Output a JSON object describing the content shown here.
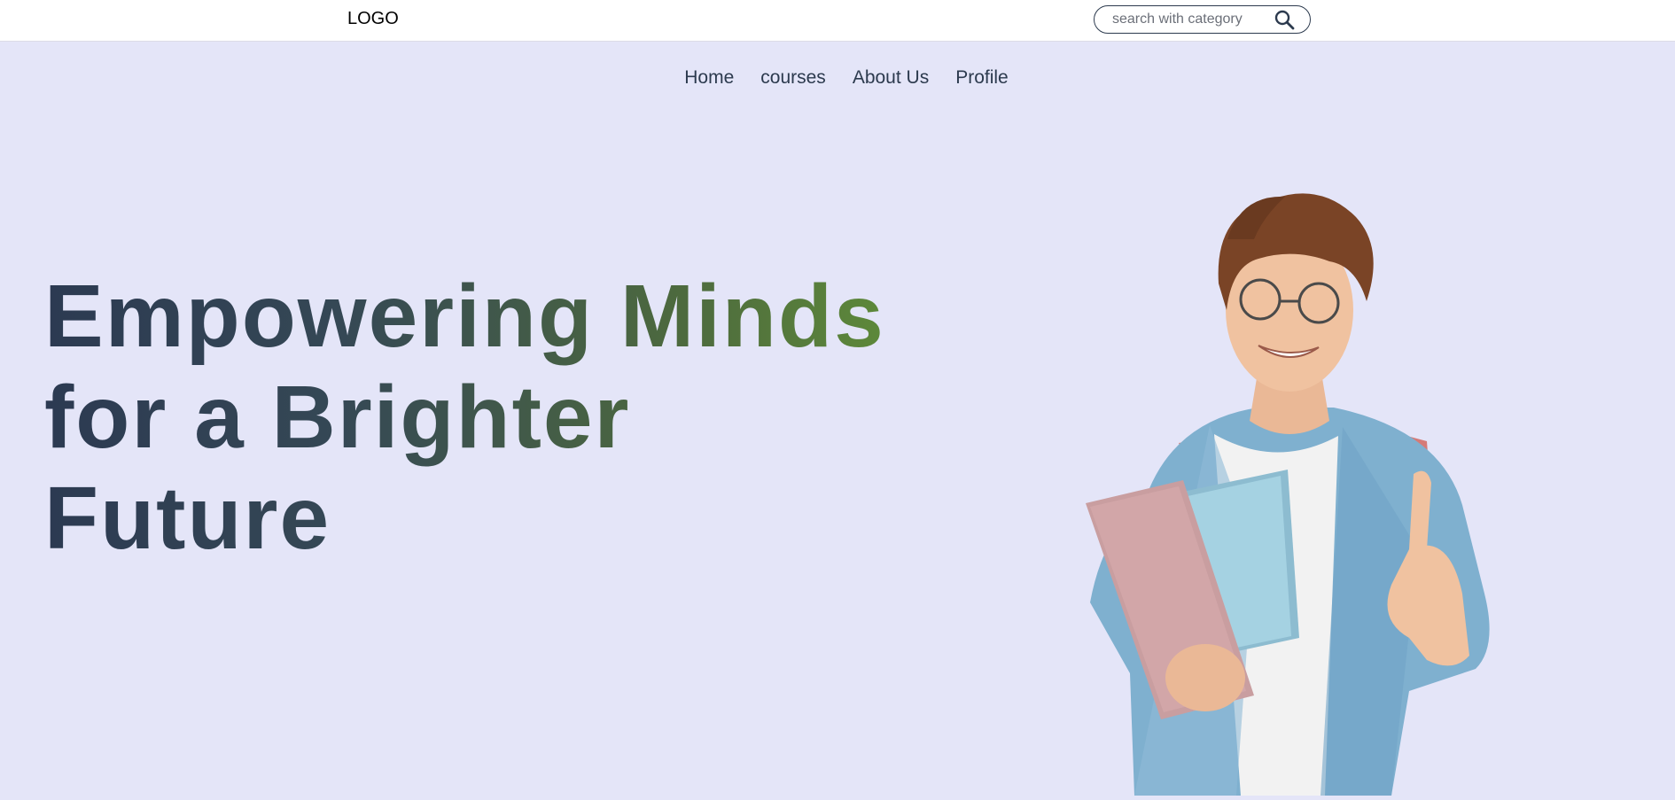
{
  "header": {
    "logo": "LOGO",
    "search": {
      "placeholder": "search with category",
      "value": ""
    }
  },
  "nav": {
    "items": [
      {
        "label": "Home"
      },
      {
        "label": "courses"
      },
      {
        "label": "About Us"
      },
      {
        "label": "Profile"
      }
    ]
  },
  "hero": {
    "title": "Empowering Minds for a Brighter Future",
    "image_icon": "student-with-books-thumbs-up"
  },
  "colors": {
    "page_bg": "#e4e5f8",
    "topbar_bg": "#ffffff",
    "nav_text": "#2c3a4e",
    "title_gradient_start": "#2c3a52",
    "title_gradient_end": "#5e8a3a"
  }
}
